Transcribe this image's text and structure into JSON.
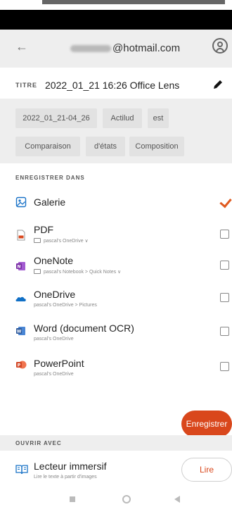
{
  "header": {
    "back_icon": "arrow-left-icon",
    "account_email": "@hotmail.com",
    "profile_icon": "profile-icon"
  },
  "title_field": {
    "label": "TITRE",
    "value": "2022_01_21 16:26 Office Lens"
  },
  "tags": [
    "2022_01_21-04_26",
    "Actilud",
    "est",
    "Comparaison",
    "d'états",
    "Composition"
  ],
  "save_section": {
    "heading": "ENREGISTRER DANS",
    "destinations": [
      {
        "name": "Galerie",
        "sub": "",
        "icon": "gallery-icon",
        "checked": true
      },
      {
        "name": "PDF",
        "sub": "pascal's OneDrive ∨",
        "icon": "pdf-icon",
        "checked": false
      },
      {
        "name": "OneNote",
        "sub": "pascal's Notebook > Quick Notes ∨",
        "icon": "onenote-icon",
        "checked": false
      },
      {
        "name": "OneDrive",
        "sub": "pascal's OneDrive > Pictures",
        "icon": "onedrive-icon",
        "checked": false
      },
      {
        "name": "Word (document OCR)",
        "sub": "pascal's OneDrive",
        "icon": "word-icon",
        "checked": false
      },
      {
        "name": "PowerPoint",
        "sub": "pascal's OneDrive",
        "icon": "powerpoint-icon",
        "checked": false
      }
    ],
    "save_button": "Enregistrer"
  },
  "open_section": {
    "heading": "OUVRIR AVEC",
    "item_name": "Lecteur immersif",
    "item_sub": "Lire le texte à partir d'images",
    "button": "Lire"
  },
  "colors": {
    "accent": "#d9471c",
    "onenote": "#7b2fa6",
    "onedrive": "#1170c6",
    "word": "#2b579a",
    "powerpoint": "#d24726"
  }
}
